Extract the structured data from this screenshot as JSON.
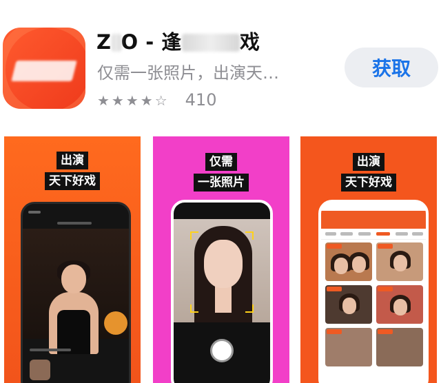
{
  "app": {
    "title_prefix": "Z",
    "title_suffix_a": "O - 逢",
    "title_suffix_b": "戏",
    "subtitle": "仅需一张照片，出演天…",
    "stars": "★★★★☆",
    "rating_count": "410",
    "get_button": "获取"
  },
  "screenshots": [
    {
      "caption_line1": "出演",
      "caption_line2": "天下好戏"
    },
    {
      "caption_line1": "仅需",
      "caption_line2": "一张照片"
    },
    {
      "caption_line1": "出演",
      "caption_line2": "天下好戏"
    }
  ],
  "colors": {
    "icon_orange": "#ef3b1c",
    "get_text": "#1a73e8",
    "shot_magenta": "#f23fc8",
    "shot_orange": "#f4561d"
  }
}
